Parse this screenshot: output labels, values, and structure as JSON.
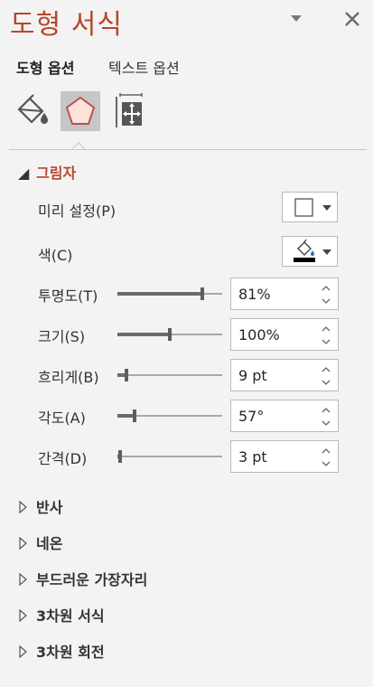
{
  "pane": {
    "title": "도형 서식",
    "tabs": [
      {
        "label": "도형 옵션",
        "active": true
      },
      {
        "label": "텍스트 옵션",
        "active": false
      }
    ],
    "icon_tabs": [
      {
        "icon": "fill-bucket-icon",
        "selected": false
      },
      {
        "icon": "pentagon-effects-icon",
        "selected": true
      },
      {
        "icon": "size-properties-icon",
        "selected": false
      }
    ]
  },
  "shadow": {
    "header": "그림자",
    "preset_label": "미리 설정(P)",
    "color_label": "색(C)",
    "rows": [
      {
        "label": "투명도(T)",
        "value": "81%",
        "level_pct": 81
      },
      {
        "label": "크기(S)",
        "value": "100%",
        "level_pct": 50
      },
      {
        "label": "흐리게(B)",
        "value": "9 pt",
        "level_pct": 9
      },
      {
        "label": "각도(A)",
        "value": "57°",
        "level_pct": 16
      },
      {
        "label": "간격(D)",
        "value": "3 pt",
        "level_pct": 3
      }
    ]
  },
  "sections": [
    "반사",
    "네온",
    "부드러운 가장자리",
    "3차원 서식",
    "3차원 회전"
  ],
  "colors": {
    "accent": "#b7472a",
    "selected_tab": "#c6c6c6",
    "shadow_color": "#000000"
  }
}
